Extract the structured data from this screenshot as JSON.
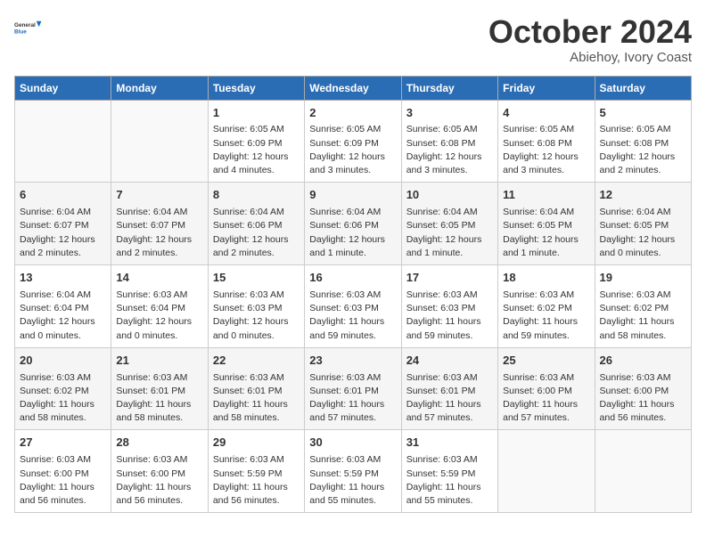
{
  "header": {
    "logo_line1": "General",
    "logo_line2": "Blue",
    "month": "October 2024",
    "location": "Abiehoу, Ivory Coast"
  },
  "days_of_week": [
    "Sunday",
    "Monday",
    "Tuesday",
    "Wednesday",
    "Thursday",
    "Friday",
    "Saturday"
  ],
  "weeks": [
    [
      {
        "day": "",
        "content": ""
      },
      {
        "day": "",
        "content": ""
      },
      {
        "day": "1",
        "content": "Sunrise: 6:05 AM\nSunset: 6:09 PM\nDaylight: 12 hours and 4 minutes."
      },
      {
        "day": "2",
        "content": "Sunrise: 6:05 AM\nSunset: 6:09 PM\nDaylight: 12 hours and 3 minutes."
      },
      {
        "day": "3",
        "content": "Sunrise: 6:05 AM\nSunset: 6:08 PM\nDaylight: 12 hours and 3 minutes."
      },
      {
        "day": "4",
        "content": "Sunrise: 6:05 AM\nSunset: 6:08 PM\nDaylight: 12 hours and 3 minutes."
      },
      {
        "day": "5",
        "content": "Sunrise: 6:05 AM\nSunset: 6:08 PM\nDaylight: 12 hours and 2 minutes."
      }
    ],
    [
      {
        "day": "6",
        "content": "Sunrise: 6:04 AM\nSunset: 6:07 PM\nDaylight: 12 hours and 2 minutes."
      },
      {
        "day": "7",
        "content": "Sunrise: 6:04 AM\nSunset: 6:07 PM\nDaylight: 12 hours and 2 minutes."
      },
      {
        "day": "8",
        "content": "Sunrise: 6:04 AM\nSunset: 6:06 PM\nDaylight: 12 hours and 2 minutes."
      },
      {
        "day": "9",
        "content": "Sunrise: 6:04 AM\nSunset: 6:06 PM\nDaylight: 12 hours and 1 minute."
      },
      {
        "day": "10",
        "content": "Sunrise: 6:04 AM\nSunset: 6:05 PM\nDaylight: 12 hours and 1 minute."
      },
      {
        "day": "11",
        "content": "Sunrise: 6:04 AM\nSunset: 6:05 PM\nDaylight: 12 hours and 1 minute."
      },
      {
        "day": "12",
        "content": "Sunrise: 6:04 AM\nSunset: 6:05 PM\nDaylight: 12 hours and 0 minutes."
      }
    ],
    [
      {
        "day": "13",
        "content": "Sunrise: 6:04 AM\nSunset: 6:04 PM\nDaylight: 12 hours and 0 minutes."
      },
      {
        "day": "14",
        "content": "Sunrise: 6:03 AM\nSunset: 6:04 PM\nDaylight: 12 hours and 0 minutes."
      },
      {
        "day": "15",
        "content": "Sunrise: 6:03 AM\nSunset: 6:03 PM\nDaylight: 12 hours and 0 minutes."
      },
      {
        "day": "16",
        "content": "Sunrise: 6:03 AM\nSunset: 6:03 PM\nDaylight: 11 hours and 59 minutes."
      },
      {
        "day": "17",
        "content": "Sunrise: 6:03 AM\nSunset: 6:03 PM\nDaylight: 11 hours and 59 minutes."
      },
      {
        "day": "18",
        "content": "Sunrise: 6:03 AM\nSunset: 6:02 PM\nDaylight: 11 hours and 59 minutes."
      },
      {
        "day": "19",
        "content": "Sunrise: 6:03 AM\nSunset: 6:02 PM\nDaylight: 11 hours and 58 minutes."
      }
    ],
    [
      {
        "day": "20",
        "content": "Sunrise: 6:03 AM\nSunset: 6:02 PM\nDaylight: 11 hours and 58 minutes."
      },
      {
        "day": "21",
        "content": "Sunrise: 6:03 AM\nSunset: 6:01 PM\nDaylight: 11 hours and 58 minutes."
      },
      {
        "day": "22",
        "content": "Sunrise: 6:03 AM\nSunset: 6:01 PM\nDaylight: 11 hours and 58 minutes."
      },
      {
        "day": "23",
        "content": "Sunrise: 6:03 AM\nSunset: 6:01 PM\nDaylight: 11 hours and 57 minutes."
      },
      {
        "day": "24",
        "content": "Sunrise: 6:03 AM\nSunset: 6:01 PM\nDaylight: 11 hours and 57 minutes."
      },
      {
        "day": "25",
        "content": "Sunrise: 6:03 AM\nSunset: 6:00 PM\nDaylight: 11 hours and 57 minutes."
      },
      {
        "day": "26",
        "content": "Sunrise: 6:03 AM\nSunset: 6:00 PM\nDaylight: 11 hours and 56 minutes."
      }
    ],
    [
      {
        "day": "27",
        "content": "Sunrise: 6:03 AM\nSunset: 6:00 PM\nDaylight: 11 hours and 56 minutes."
      },
      {
        "day": "28",
        "content": "Sunrise: 6:03 AM\nSunset: 6:00 PM\nDaylight: 11 hours and 56 minutes."
      },
      {
        "day": "29",
        "content": "Sunrise: 6:03 AM\nSunset: 5:59 PM\nDaylight: 11 hours and 56 minutes."
      },
      {
        "day": "30",
        "content": "Sunrise: 6:03 AM\nSunset: 5:59 PM\nDaylight: 11 hours and 55 minutes."
      },
      {
        "day": "31",
        "content": "Sunrise: 6:03 AM\nSunset: 5:59 PM\nDaylight: 11 hours and 55 minutes."
      },
      {
        "day": "",
        "content": ""
      },
      {
        "day": "",
        "content": ""
      }
    ]
  ]
}
